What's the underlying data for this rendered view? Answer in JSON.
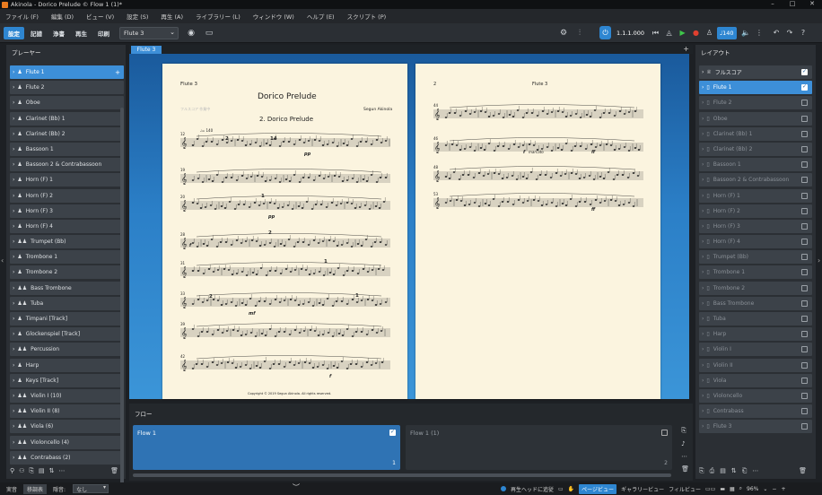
{
  "window": {
    "title": "Akinola - Dorico Prelude © Flow 1 (1)*",
    "controls": [
      "–",
      "□",
      "✕"
    ]
  },
  "menu": [
    "ファイル (F)",
    "編集 (D)",
    "ビュー (V)",
    "設定 (S)",
    "再生 (A)",
    "ライブラリー (L)",
    "ウィンドウ (W)",
    "ヘルプ (E)",
    "スクリプト (P)"
  ],
  "modes": [
    "設定",
    "記譜",
    "浄書",
    "再生",
    "印刷"
  ],
  "active_mode": "設定",
  "layout_select": "Flute 3",
  "transport": {
    "time": "1.1.1.000",
    "tempo": "♩140"
  },
  "players": {
    "title": "プレーヤー",
    "items": [
      {
        "label": "Flute 1",
        "icon": "single",
        "selected": true
      },
      {
        "label": "Flute 2",
        "icon": "single"
      },
      {
        "label": "Oboe",
        "icon": "single"
      },
      {
        "label": "Clarinet (Bb) 1",
        "icon": "single"
      },
      {
        "label": "Clarinet (Bb) 2",
        "icon": "single"
      },
      {
        "label": "Bassoon 1",
        "icon": "single"
      },
      {
        "label": "Bassoon 2 & Contrabassoon",
        "icon": "single"
      },
      {
        "label": "Horn (F) 1",
        "icon": "single"
      },
      {
        "label": "Horn (F) 2",
        "icon": "single"
      },
      {
        "label": "Horn (F) 3",
        "icon": "single"
      },
      {
        "label": "Horn (F) 4",
        "icon": "single"
      },
      {
        "label": "Trumpet (Bb)",
        "icon": "section"
      },
      {
        "label": "Trombone 1",
        "icon": "single"
      },
      {
        "label": "Trombone 2",
        "icon": "single"
      },
      {
        "label": "Bass Trombone",
        "icon": "section"
      },
      {
        "label": "Tuba",
        "icon": "section"
      },
      {
        "label": "Timpani [Track]",
        "icon": "single"
      },
      {
        "label": "Glockenspiel [Track]",
        "icon": "single"
      },
      {
        "label": "Percussion",
        "icon": "section"
      },
      {
        "label": "Harp",
        "icon": "single"
      },
      {
        "label": "Keys [Track]",
        "icon": "single"
      },
      {
        "label": "Violin I (10)",
        "icon": "section"
      },
      {
        "label": "Violin II (8)",
        "icon": "section"
      },
      {
        "label": "Viola (6)",
        "icon": "section"
      },
      {
        "label": "Violoncello (4)",
        "icon": "section"
      },
      {
        "label": "Contrabass (2)",
        "icon": "section"
      }
    ]
  },
  "tab": {
    "label": "Flute 3"
  },
  "score": {
    "page1": {
      "part": "Flute 3",
      "title": "Dorico Prelude",
      "subtitle": "2. Dorico Prelude",
      "composer": "Segun Akinola",
      "faint": "フルスコア 作業中",
      "copyright": "Copyright © 2019 Segun Akinola. All rights reserved.",
      "tempo": "♩= 140",
      "measures": [
        "12",
        "19",
        "20",
        "28",
        "31",
        "33",
        "39",
        "42"
      ],
      "rest_counts": [
        "2",
        "14",
        "1",
        "2",
        "1",
        "2",
        "1"
      ],
      "dynamics": [
        "pp",
        "pp",
        "f",
        "mf",
        "f"
      ]
    },
    "page2": {
      "page_num": "2",
      "part": "Flute 3",
      "measures": [
        "44",
        "46",
        "48",
        "53"
      ],
      "dynamics": [
        "f",
        "ff",
        "ff"
      ],
      "marcato": "marcato"
    }
  },
  "layouts": {
    "title": "レイアウト",
    "items": [
      {
        "label": "フルスコア",
        "checked": true,
        "full": true
      },
      {
        "label": "Flute 1",
        "checked": true,
        "selected": true
      },
      {
        "label": "Flute 2"
      },
      {
        "label": "Oboe"
      },
      {
        "label": "Clarinet (Bb) 1"
      },
      {
        "label": "Clarinet (Bb) 2"
      },
      {
        "label": "Bassoon 1"
      },
      {
        "label": "Bassoon 2 & Contrabassoon"
      },
      {
        "label": "Horn (F) 1"
      },
      {
        "label": "Horn (F) 2"
      },
      {
        "label": "Horn (F) 3"
      },
      {
        "label": "Horn (F) 4"
      },
      {
        "label": "Trumpet (Bb)"
      },
      {
        "label": "Trombone 1"
      },
      {
        "label": "Trombone 2"
      },
      {
        "label": "Bass Trombone"
      },
      {
        "label": "Tuba"
      },
      {
        "label": "Harp"
      },
      {
        "label": "Violin I"
      },
      {
        "label": "Violin II"
      },
      {
        "label": "Viola"
      },
      {
        "label": "Violoncello"
      },
      {
        "label": "Contrabass"
      },
      {
        "label": "Flute 3"
      }
    ]
  },
  "flows": {
    "title": "フロー",
    "cards": [
      {
        "label": "Flow 1",
        "num": "1",
        "checked": true,
        "selected": true
      },
      {
        "label": "Flow 1 (1)",
        "num": "2",
        "checked": false
      }
    ]
  },
  "status": {
    "left": [
      "実音",
      "移調表",
      "隠音:"
    ],
    "select": "なし",
    "right": [
      "再生ヘッドに追従",
      "ページビュー",
      "ギャラリービュー",
      "フィルビュー"
    ],
    "zoom": "96%"
  }
}
